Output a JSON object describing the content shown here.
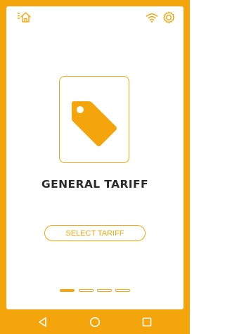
{
  "status_bar": {
    "home_icon": "home-icon",
    "wifi_icon": "wifi-icon",
    "settings_icon": "settings-icon"
  },
  "main": {
    "card_icon": "price-tag-icon",
    "title": "GENERAL TARIFF",
    "select_button_label": "SELECT TARIFF"
  },
  "pager": {
    "count": 4,
    "active_index": 0
  },
  "nav_bar": {
    "back_icon": "back-triangle-icon",
    "home_icon": "home-circle-icon",
    "recents_icon": "recents-square-icon"
  },
  "colors": {
    "accent": "#f5a50c",
    "text": "#2b2b2b",
    "background": "#ffffff"
  }
}
